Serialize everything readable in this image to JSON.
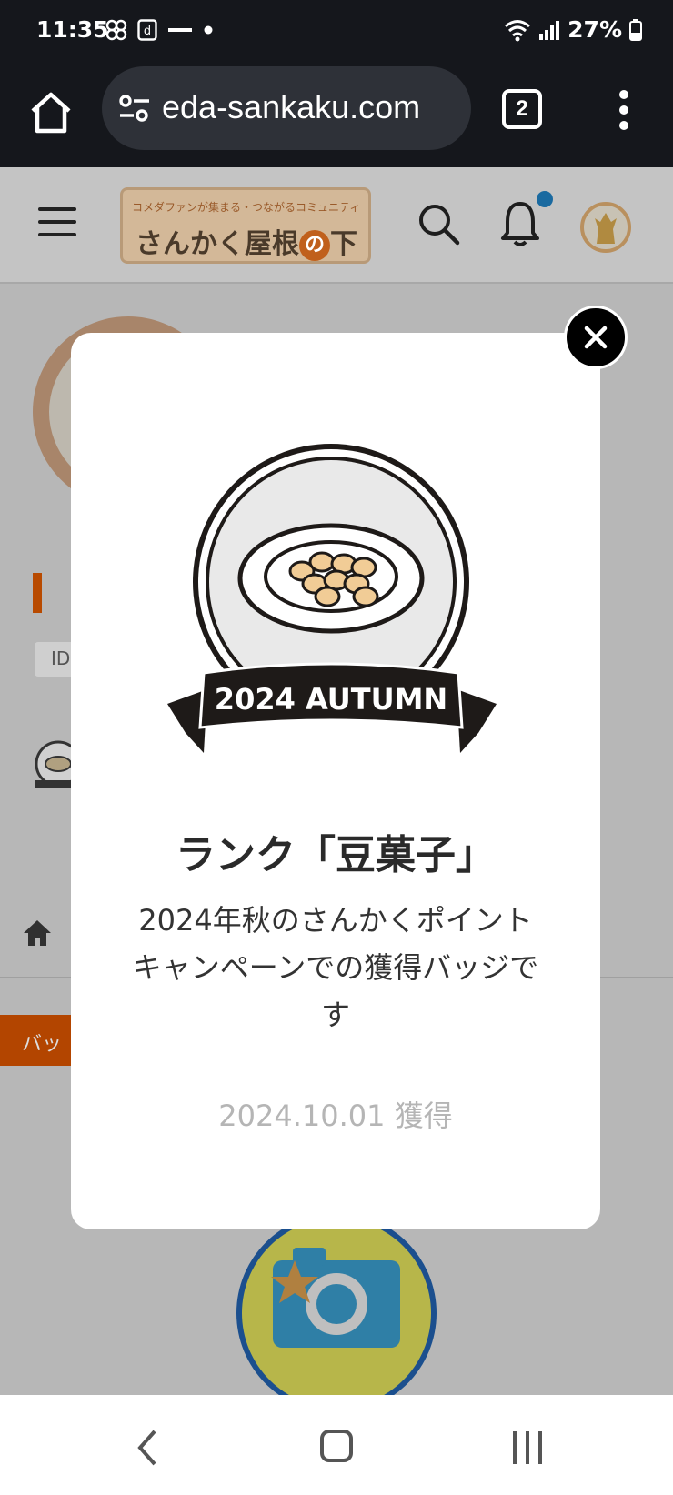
{
  "status_bar": {
    "time": "11:35",
    "battery": "27%"
  },
  "browser": {
    "url": "eda-sankaku.com",
    "tab_count": "2"
  },
  "site_header": {
    "logo_tagline": "コメダファンが集まる・つながるコミュニティ",
    "logo_title": "さんかく屋根",
    "logo_no": "の",
    "logo_suffix": "下"
  },
  "background": {
    "id_chip": "ID",
    "orange_button": "バッ"
  },
  "modal": {
    "badge_banner": "2024 AUTUMN",
    "title": "ランク「豆菓子」",
    "description": "2024年秋のさんかくポイントキャンペーンでの獲得バッジです",
    "date": "2024.10.01 獲得"
  },
  "colors": {
    "status_bg": "#15171c",
    "accent_orange": "#b34500",
    "notification_dot": "#1a6aa0"
  }
}
